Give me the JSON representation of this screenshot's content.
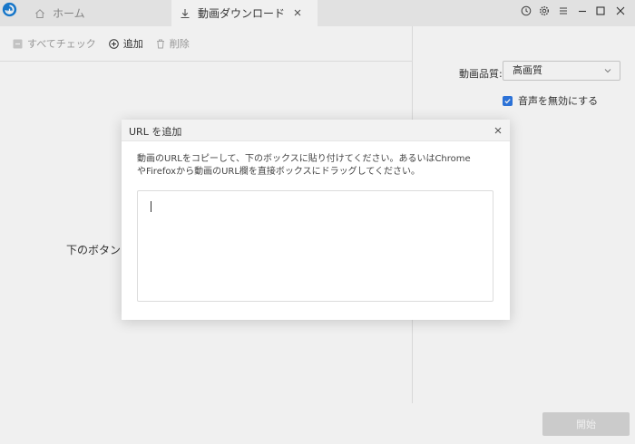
{
  "tabs": [
    {
      "label": "ホーム"
    },
    {
      "label": "動画ダウンロード"
    }
  ],
  "toolbar": {
    "select_all": "すべてチェック",
    "add": "追加",
    "delete": "削除"
  },
  "main": {
    "hint": "下のボタンを"
  },
  "settings": {
    "quality_label": "動画品質:",
    "quality_value": "高画質",
    "mute_label": "音声を無効にする",
    "mute_checked": true
  },
  "footer": {
    "start_label": "開始"
  },
  "dialog": {
    "title": "URL を追加",
    "description_line1": "動画のURLをコピーして、下のボックスに貼り付けてください。あるいはChrome",
    "description_line2": "やFirefoxから動画のURL欄を直接ボックスにドラッグしてください。",
    "input_value": ""
  },
  "colors": {
    "accent": "#2f7ae5",
    "titlebar": "#f0f0f0",
    "disabled_button": "#d8d8d8"
  }
}
